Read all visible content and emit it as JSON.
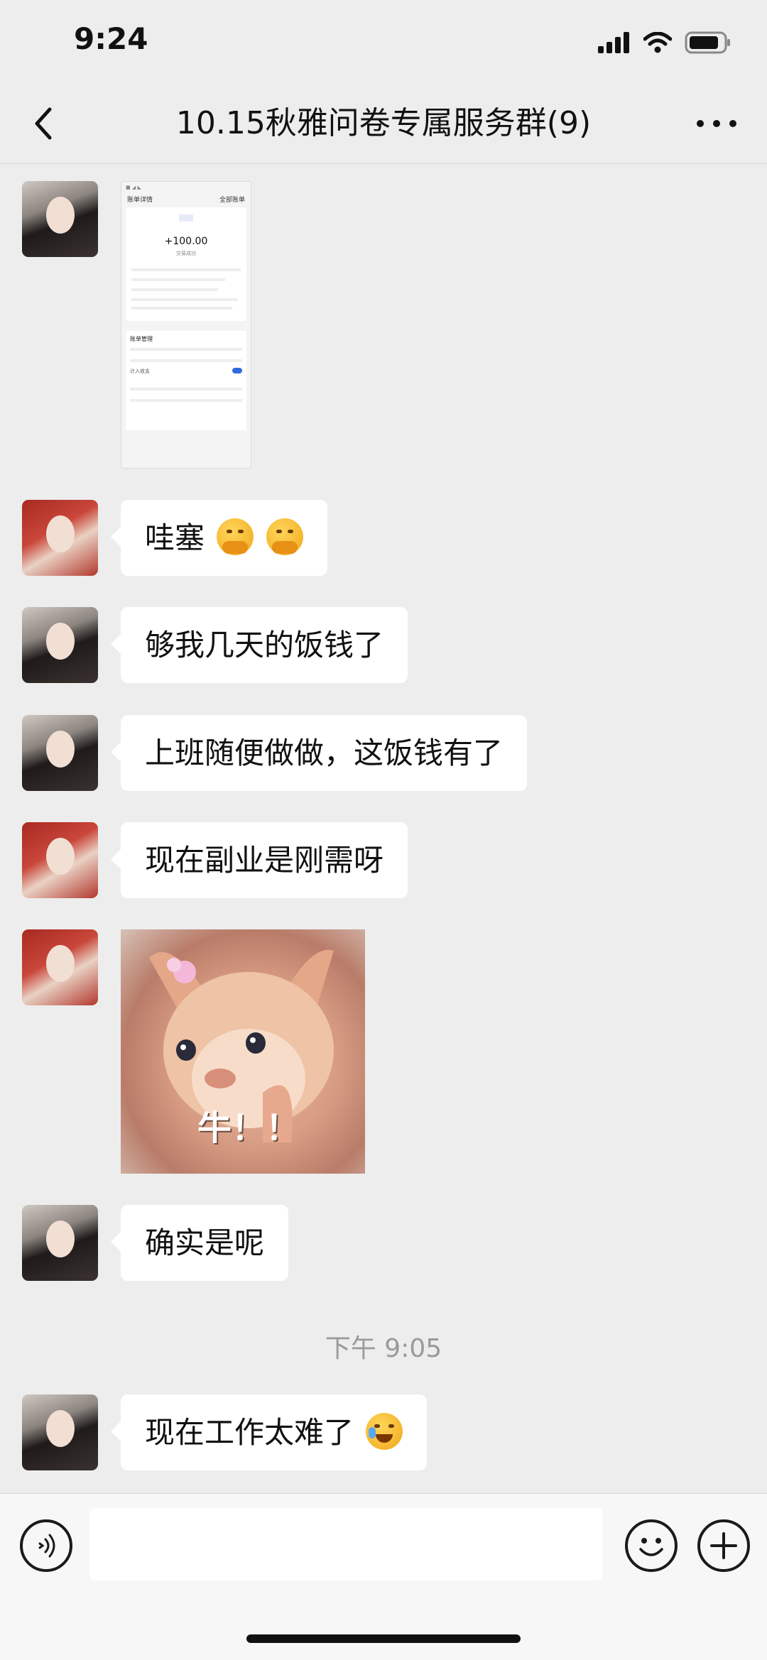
{
  "status_bar": {
    "time": "9:24"
  },
  "nav": {
    "title": "10.15秋雅问卷专属服务群(9)"
  },
  "screenshot_receipt": {
    "header_left": "账单详情",
    "header_right": "全部账单",
    "amount": "+100.00",
    "status": "交易成功",
    "section": "账单管理",
    "toggle_label": "计入收支"
  },
  "messages": [
    {
      "text": "哇塞"
    },
    {
      "text": "够我几天的饭钱了"
    },
    {
      "text": "上班随便做做，这饭钱有了"
    },
    {
      "text": "现在副业是刚需呀"
    },
    {
      "sticker_text": "牛！！"
    },
    {
      "text": "确实是呢"
    },
    {
      "text": "现在工作太难了"
    }
  ],
  "time_divider": "下午 9:05",
  "icons": {
    "back": "back-chevron-icon",
    "more": "more-dots-icon",
    "voice": "voice-icon",
    "emoji": "emoji-icon",
    "add": "plus-icon"
  }
}
